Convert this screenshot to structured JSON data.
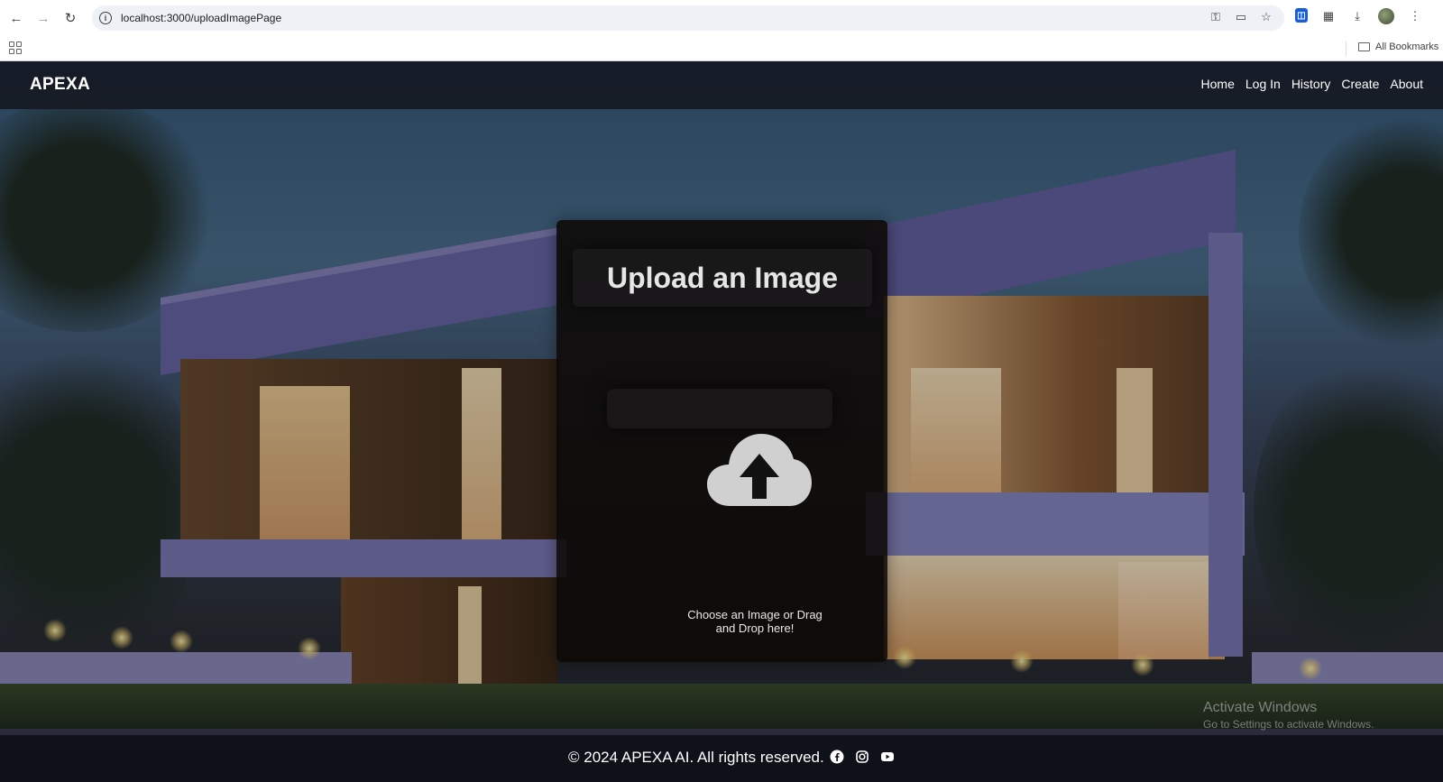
{
  "browser": {
    "url": "localhost:3000/uploadImagePage",
    "bookmarks_label": "All Bookmarks",
    "nav_icons": [
      "back-icon",
      "forward-icon",
      "reload-icon"
    ],
    "address_icons": [
      "password-key-icon",
      "install-app-icon",
      "bookmark-star-icon"
    ],
    "toolbar_icons": [
      "bitwarden-icon",
      "extensions-icon",
      "downloads-icon",
      "profile-avatar",
      "menu-icon"
    ]
  },
  "site": {
    "brand": "APEXA",
    "nav": [
      "Home",
      "Log In",
      "History",
      "Create",
      "About"
    ]
  },
  "upload": {
    "title": "Upload an Image",
    "drop_text_line1": "Choose an Image or Drag",
    "drop_text_line2": "and Drop here!",
    "icon": "cloud-upload-icon"
  },
  "footer": {
    "copyright": "© 2024 APEXA AI. All rights reserved.",
    "social_icons": [
      "facebook-icon",
      "instagram-icon",
      "youtube-icon"
    ]
  },
  "watermark": {
    "line1": "Activate Windows",
    "line2": "Go to Settings to activate Windows."
  },
  "colors": {
    "navbar_bg": "#14161e",
    "panel_bg": "#0c0806",
    "text": "#ffffff",
    "upload_icon": "#d0d0d0"
  }
}
